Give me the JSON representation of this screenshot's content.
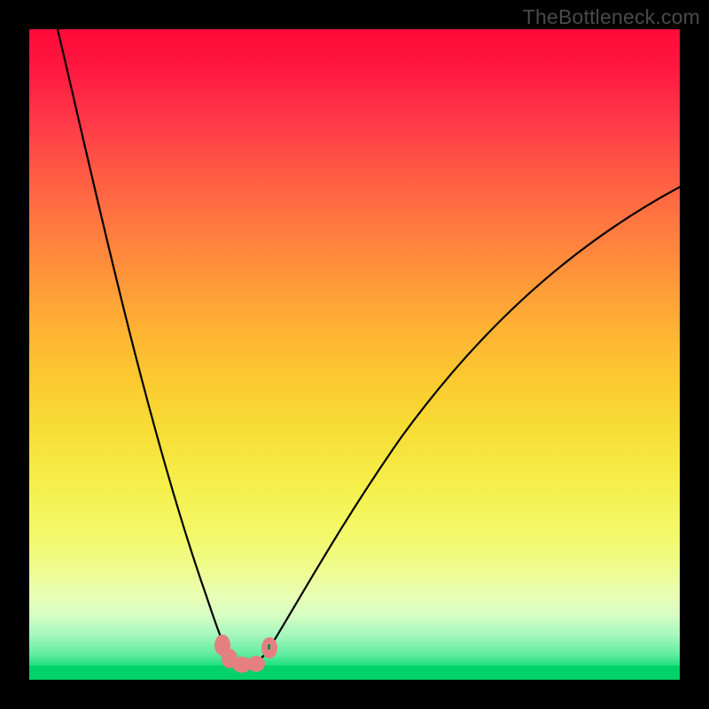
{
  "watermark": {
    "text": "TheBottleneck.com"
  },
  "chart_data": {
    "type": "line",
    "title": "",
    "xlabel": "",
    "ylabel": "",
    "xlim": [
      0,
      100
    ],
    "ylim": [
      0,
      100
    ],
    "grid": false,
    "series": [
      {
        "name": "left-branch",
        "x": [
          4,
          6,
          8,
          10,
          12,
          14,
          16,
          18,
          20,
          22,
          24,
          26,
          28,
          29,
          30
        ],
        "y": [
          100,
          92,
          84,
          76,
          68,
          60,
          52,
          44,
          36,
          28,
          20,
          12,
          6,
          3,
          2
        ]
      },
      {
        "name": "valley",
        "x": [
          30,
          31,
          32,
          33,
          34,
          35,
          36
        ],
        "y": [
          2,
          1.2,
          1,
          1,
          1,
          1.2,
          2
        ]
      },
      {
        "name": "right-branch",
        "x": [
          36,
          38,
          40,
          44,
          48,
          52,
          56,
          60,
          66,
          72,
          78,
          84,
          90,
          96,
          100
        ],
        "y": [
          2,
          4,
          7,
          13,
          19,
          25,
          31,
          36,
          44,
          51,
          57,
          63,
          68,
          73,
          76
        ]
      }
    ],
    "markers": [
      {
        "name": "highlight-a",
        "x": 29.5,
        "y": 4
      },
      {
        "name": "highlight-b",
        "x": 31.0,
        "y": 2
      },
      {
        "name": "highlight-c",
        "x": 33.5,
        "y": 1.5
      },
      {
        "name": "highlight-d",
        "x": 36.5,
        "y": 4
      }
    ],
    "background_gradient": {
      "top": "#ff0a3a",
      "mid": "#f7de36",
      "bottom": "#00d56a"
    }
  }
}
